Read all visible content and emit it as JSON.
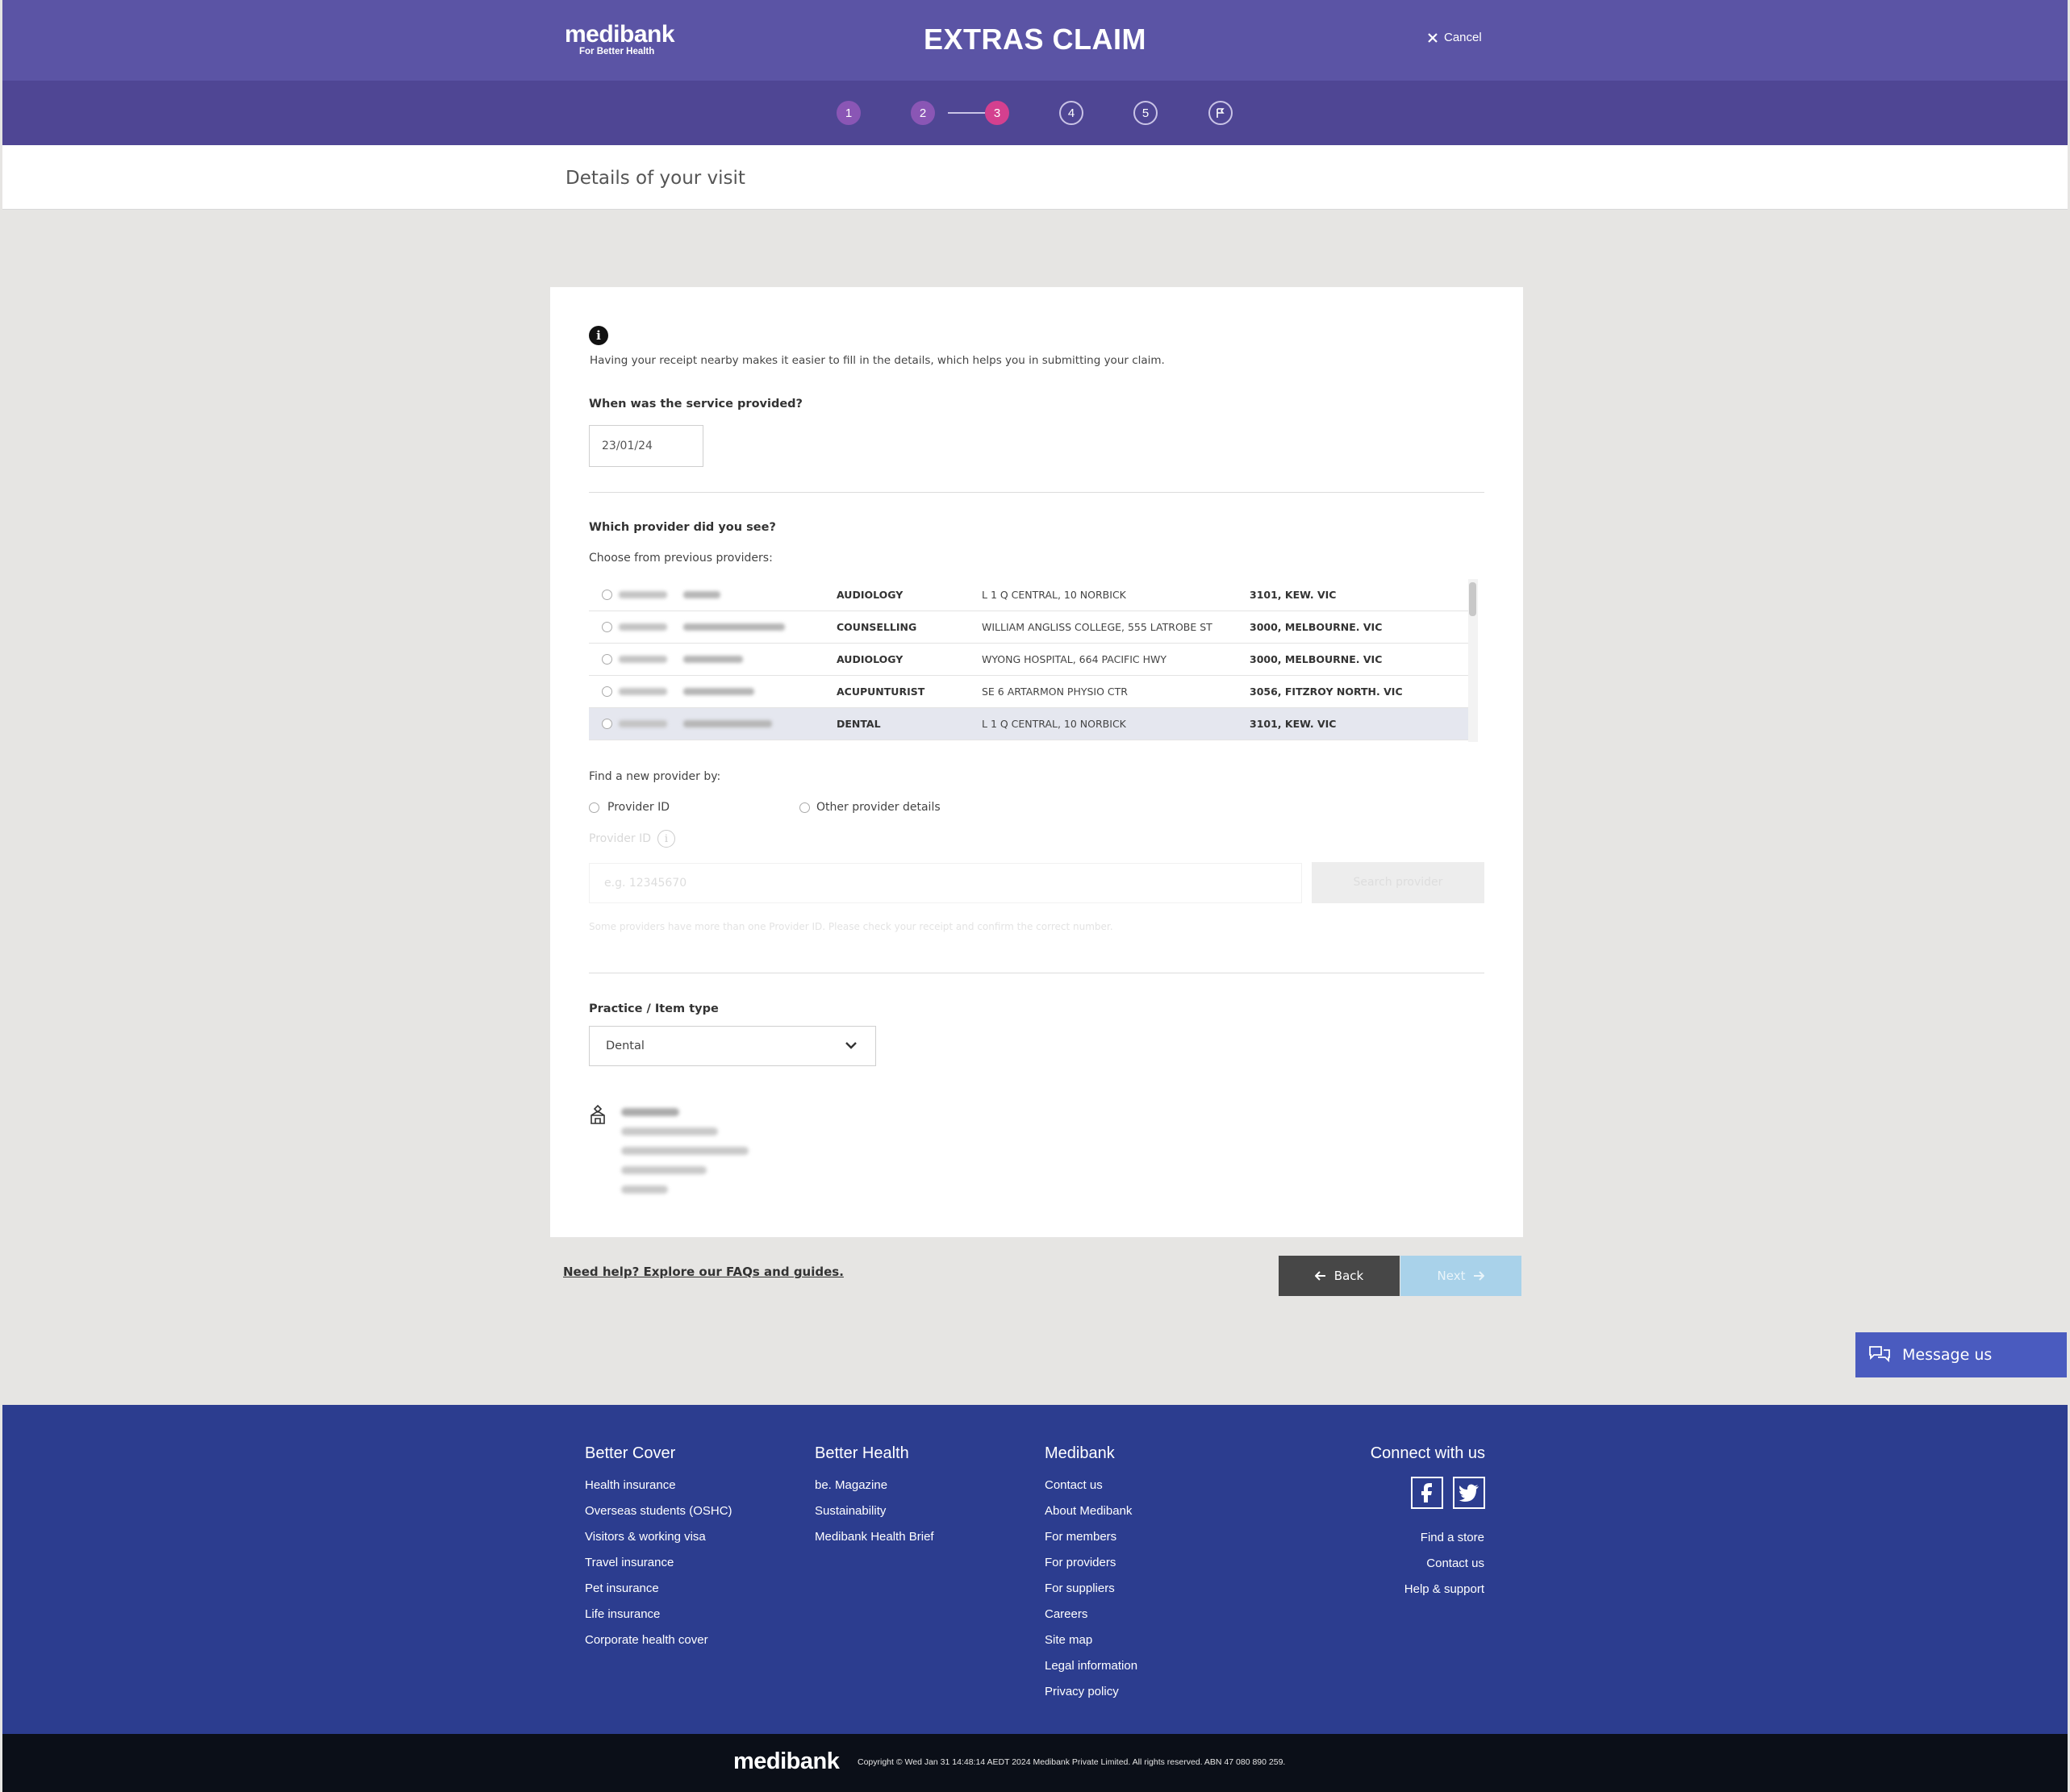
{
  "header": {
    "brand": "medibank",
    "tagline": "For Better Health",
    "title": "EXTRAS CLAIM",
    "cancel_label": "Cancel"
  },
  "steps": {
    "items": [
      "1",
      "2",
      "3",
      "4",
      "5"
    ],
    "current": 3,
    "final_icon": "flag-icon"
  },
  "page": {
    "subtitle": "Details of your visit"
  },
  "form": {
    "info_text": "Having your receipt nearby makes it easier to fill in the details, which helps you in submitting your claim.",
    "date_question": "When was the service provided?",
    "date_value": "23/01/24",
    "provider_question": "Which provider did you see?",
    "previous_label": "Choose from previous providers:",
    "providers": [
      {
        "type": "AUDIOLOGY",
        "address": "L 1 Q CENTRAL, 10 NORBICK",
        "city": "3101, KEW. VIC"
      },
      {
        "type": "COUNSELLING",
        "address": "WILLIAM ANGLISS COLLEGE, 555 LATROBE ST",
        "city": "3000, MELBOURNE. VIC"
      },
      {
        "type": "AUDIOLOGY",
        "address": "WYONG HOSPITAL, 664 PACIFIC HWY",
        "city": "3000, MELBOURNE. VIC"
      },
      {
        "type": "ACUPUNTURIST",
        "address": "SE 6 ARTARMON PHYSIO CTR",
        "city": "3056, FITZROY NORTH. VIC"
      },
      {
        "type": "DENTAL",
        "address": "L 1 Q CENTRAL, 10 NORBICK",
        "city": "3101, KEW. VIC"
      }
    ],
    "find_label": "Find a new provider by:",
    "option_provider_id": "Provider ID",
    "option_other": "Other provider details",
    "provider_id_label": "Provider ID",
    "provider_id_placeholder": "e.g. 12345670",
    "search_button": "Search provider",
    "provider_hint": "Some providers have more than one Provider ID. Please check your receipt and confirm the correct number.",
    "practice_label": "Practice / Item type",
    "practice_value": "Dental"
  },
  "nav": {
    "help_link": "Need help? Explore our FAQs and guides.",
    "back_label": "Back",
    "next_label": "Next"
  },
  "chat": {
    "label": "Message us"
  },
  "footer": {
    "col1": {
      "heading": "Better Cover",
      "links": [
        "Health insurance",
        "Overseas students (OSHC)",
        "Visitors & working visa",
        "Travel insurance",
        "Pet insurance",
        "Life insurance",
        "Corporate health cover"
      ]
    },
    "col2": {
      "heading": "Better Health",
      "links": [
        "be. Magazine",
        "Sustainability",
        "Medibank Health Brief"
      ]
    },
    "col3": {
      "heading": "Medibank",
      "links": [
        "Contact us",
        "About Medibank",
        "For members",
        "For providers",
        "For suppliers",
        "Careers",
        "Site map",
        "Legal information",
        "Privacy policy"
      ]
    },
    "col4": {
      "heading": "Connect with us",
      "links": [
        "Find a store",
        "Contact us",
        "Help & support"
      ]
    },
    "brand": "medibank",
    "copyright": "Copyright © Wed Jan 31 14:48:14 AEDT 2024 Medibank Private Limited. All rights reserved. ABN 47 080 890 259."
  },
  "colors": {
    "header_bg": "#5b54a5",
    "steps_bg": "#4f4694",
    "step_done": "#8a56b5",
    "step_active": "#d4408f",
    "footer_bg": "#2c3d8f",
    "chat_bg": "#4a5bbf",
    "next_disabled": "#a9d2ea"
  }
}
